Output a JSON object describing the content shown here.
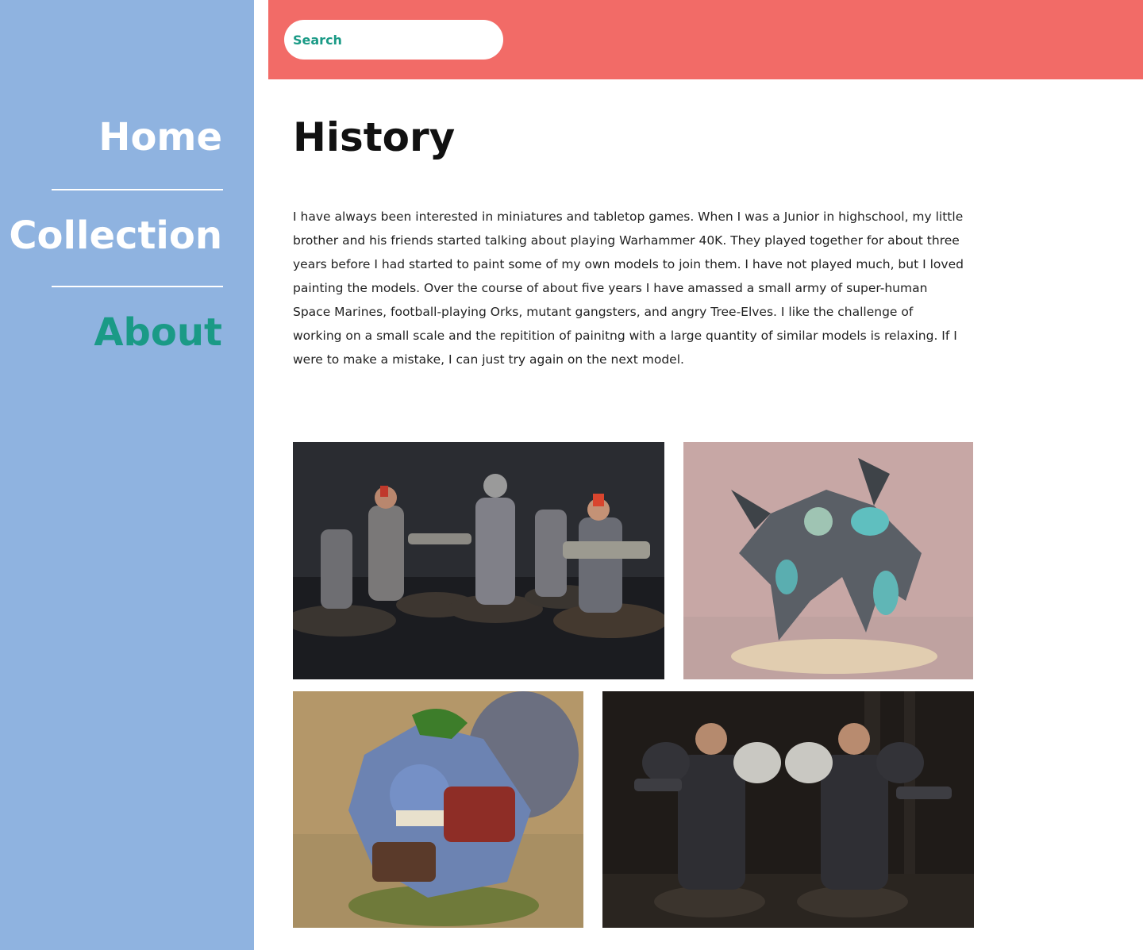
{
  "sidebar": {
    "items": [
      {
        "label": "Home",
        "active": false
      },
      {
        "label": "Collection",
        "active": false
      },
      {
        "label": "About",
        "active": true
      }
    ]
  },
  "header": {
    "search": {
      "placeholder": "Search",
      "value": ""
    }
  },
  "main": {
    "title": "History",
    "paragraph": "I have always been interested in miniatures and tabletop games. When I was a Junior in highschool, my little brother and his friends started talking about playing Warhammer 40K. They played together for about three years before I had started to paint some of my own models to join them. I have not played much, but I loved painting the models. Over the course of about five years I have amassed a small army of super-human Space Marines, football-playing Orks, mutant gangsters, and angry Tree-Elves. I like the challenge of working on a small scale and the repitition of painitng with a large quantity of similar models is relaxing. If I were to make a mistake, I can just try again on the next model."
  },
  "colors": {
    "sidebar_bg": "#8fb3e0",
    "header_bg": "#f26b67",
    "accent": "#1a9a86"
  }
}
